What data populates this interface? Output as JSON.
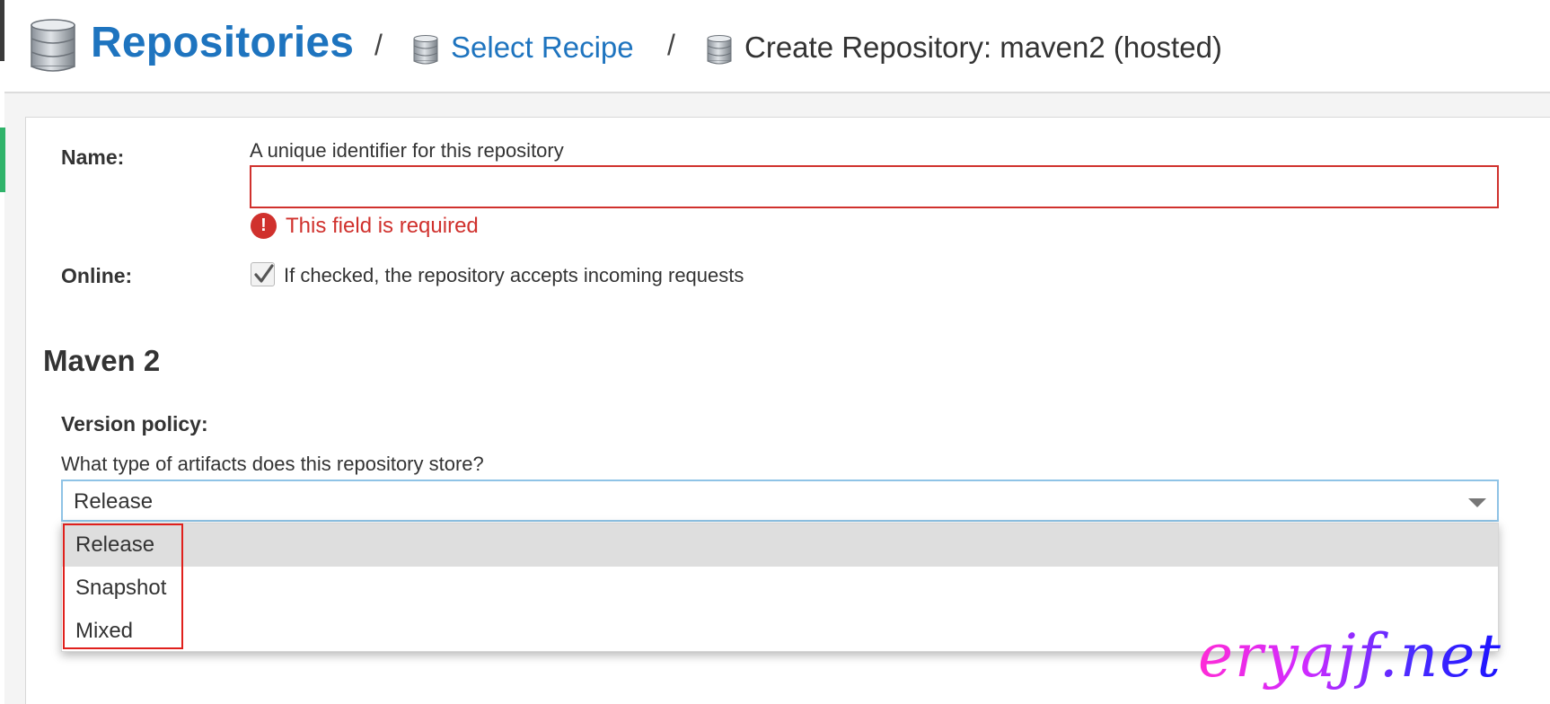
{
  "header": {
    "title": "Repositories",
    "separator": "/",
    "breadcrumb_link": "Select Recipe",
    "breadcrumb_current": "Create Repository: maven2 (hosted)"
  },
  "form": {
    "name": {
      "label": "Name:",
      "help": "A unique identifier for this repository",
      "value": "",
      "error_icon": "!",
      "error": "This field is required"
    },
    "online": {
      "label": "Online:",
      "checked": true,
      "help": "If checked, the repository accepts incoming requests"
    },
    "section_title": "Maven 2",
    "version_policy": {
      "label": "Version policy:",
      "help": "What type of artifacts does this repository store?",
      "selected": "Release",
      "options": [
        "Release",
        "Snapshot",
        "Mixed"
      ]
    }
  },
  "watermark": "eryajf.net",
  "icons": {
    "header": "database-icon",
    "breadcrumb": "database-icon",
    "error": "exclamation-circle-icon",
    "checkbox": "check-icon",
    "select": "caret-down-icon"
  },
  "colors": {
    "brand_blue": "#1e74bf",
    "error_red": "#d0312d",
    "select_border": "#8fc3e6",
    "highlight_option": "#dedede",
    "annotation_red": "#e0201c",
    "green_tab": "#2fb36a"
  }
}
